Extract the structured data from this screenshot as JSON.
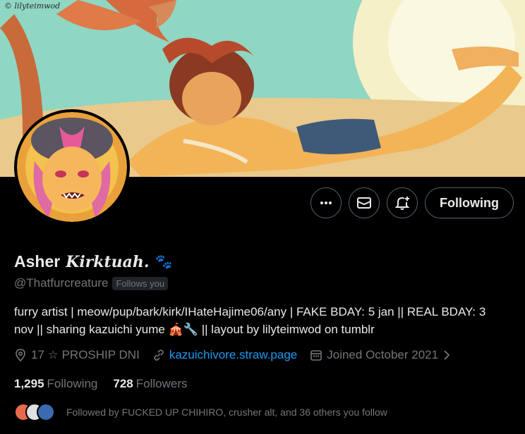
{
  "banner": {
    "watermark": "© lilyteimwod"
  },
  "profile": {
    "display_name": "Asher",
    "name_suffix": "Kirktuah.",
    "name_emoji": "🐾",
    "handle": "@Thatfurcreature",
    "follows_you": "Follows you",
    "bio_text": "furry artist | meow/pup/bark/kirk/IHateHajime06/any | FAKE BDAY: 5 jan || REAL BDAY: 3 nov || sharing kazuichi yume",
    "bio_emojis": "🎪🔧",
    "bio_end": "|| layout by lilyteimwod on tumblr",
    "location": "17 ☆ PROSHIP DNI",
    "website": "kazuichivore.straw.page",
    "joined": "Joined October 2021",
    "following_count": "1,295",
    "following_label": "Following",
    "followers_count": "728",
    "followers_label": "Followers",
    "followed_by": "Followed by FUCKED UP CHIHIRO, crusher alt, and 36 others you follow"
  },
  "actions": {
    "more_icon": "more-icon",
    "message_icon": "mail-icon",
    "notify_icon": "bell-plus-icon",
    "follow_label": "Following"
  },
  "colors": {
    "accent": "#1d9bf0",
    "muted": "#71767b",
    "text": "#e7e9ea",
    "border": "#536471"
  }
}
